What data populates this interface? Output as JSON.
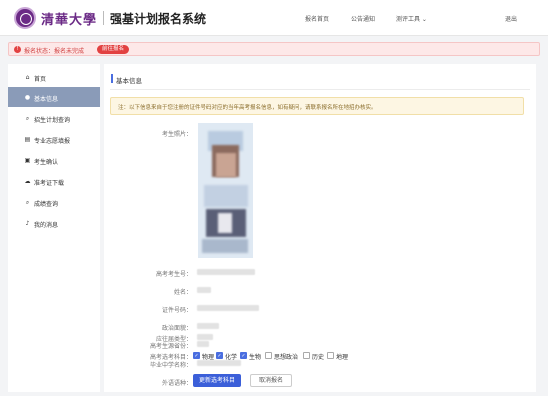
{
  "header": {
    "university": "清華大學",
    "title": "强基计划报名系统",
    "nav": [
      {
        "label": "报名首页"
      },
      {
        "label": "公告通知"
      },
      {
        "label": "测评工具 ⌄"
      }
    ],
    "logout": "退出"
  },
  "alert": {
    "status": "报名状态：报名未完成",
    "action": "前往报名"
  },
  "sidebar": {
    "items": [
      {
        "label": "首页",
        "icon": "home-icon",
        "glyph": "⌂"
      },
      {
        "label": "基本信息",
        "icon": "user-icon",
        "glyph": "●"
      },
      {
        "label": "招生计划查询",
        "icon": "search-icon",
        "glyph": "⌕"
      },
      {
        "label": "专业志愿填报",
        "icon": "form-icon",
        "glyph": "▤"
      },
      {
        "label": "考生确认",
        "icon": "confirm-icon",
        "glyph": "▣"
      },
      {
        "label": "准考证下载",
        "icon": "cloud-download-icon",
        "glyph": "☁"
      },
      {
        "label": "成绩查询",
        "icon": "search-icon",
        "glyph": "⌕"
      },
      {
        "label": "我的消息",
        "icon": "bell-icon",
        "glyph": "♪"
      }
    ],
    "active_index": 1
  },
  "main": {
    "section_title": "基本信息",
    "notice": "注：以下信息来自于您注册的证件号码对应的当年高考报名信息，如有疑问，请联系报名所在地招办核实。",
    "fields": {
      "photo_label": "考生照片：",
      "exam_no_label": "高考考生号：",
      "name_label": "姓名：",
      "id_label": "证件号码：",
      "politics_label": "政治面貌：",
      "province_label": "高考生源省份：",
      "school_label": "毕业中学名称：",
      "language_label": "外语语种：",
      "category_label": "应往届类型：",
      "subjects_label": "高考选考科目："
    },
    "subjects": [
      {
        "name": "物理",
        "checked": true
      },
      {
        "name": "化学",
        "checked": true
      },
      {
        "name": "生物",
        "checked": true
      },
      {
        "name": "思想政治",
        "checked": false
      },
      {
        "name": "历史",
        "checked": false
      },
      {
        "name": "地理",
        "checked": false
      }
    ],
    "buttons": {
      "update": "更新选考科目",
      "cancel": "取消报名"
    }
  },
  "colors": {
    "brand_purple": "#6b2a86",
    "primary_blue": "#3b5fd9",
    "alert_red": "#e24141",
    "sidebar_active": "#8a9bb8"
  }
}
